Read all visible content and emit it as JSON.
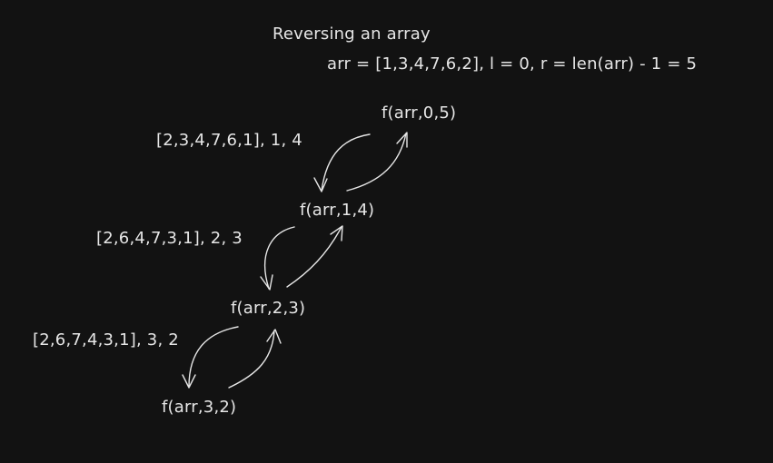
{
  "title": "Reversing an array",
  "setup": "arr = [1,3,4,7,6,2], l = 0, r = len(arr) - 1 = 5",
  "calls": [
    {
      "label": "f(arr,0,5)"
    },
    {
      "label": "f(arr,1,4)"
    },
    {
      "label": "f(arr,2,3)"
    },
    {
      "label": "f(arr,3,2)"
    }
  ],
  "states": [
    {
      "label": "[2,3,4,7,6,1], 1, 4"
    },
    {
      "label": "[2,6,4,7,3,1], 2, 3"
    },
    {
      "label": "[2,6,7,4,3,1], 3, 2"
    }
  ]
}
